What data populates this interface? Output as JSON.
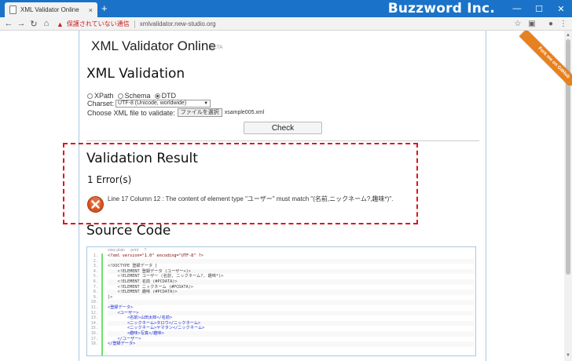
{
  "browser": {
    "tab_title": "XML Validator Online",
    "tab_close": "×",
    "new_tab": "+",
    "brand": "Buzzword Inc.",
    "minimize": "—",
    "maximize": "☐",
    "close": "✕",
    "security_label": "保護されていない通信",
    "url": "xmlvalidator.new-studio.org"
  },
  "app": {
    "title": "XML Validator Online",
    "beta": "BETA",
    "ribbon": "Fork me on GitHub"
  },
  "validation": {
    "heading": "XML Validation",
    "modes": [
      {
        "label": "XPath",
        "checked": false
      },
      {
        "label": "Schema",
        "checked": false
      },
      {
        "label": "DTD",
        "checked": true
      }
    ],
    "charset_label": "Charset:",
    "charset_value": "UTF-8 (Unicode, worldwide)",
    "file_label": "Choose XML file to validate:",
    "file_button": "ファイルを選択",
    "file_name": "xsample005.xml",
    "check_button": "Check"
  },
  "result": {
    "heading": "Validation Result",
    "error_count": "1 Error(s)",
    "error_message": "Line 17 Column 12 : The content of element type \"ユーザー\" must match \"(名前,ニックネーム?,趣味*)\"."
  },
  "source": {
    "heading": "Source Code",
    "toolbar": [
      "view plain",
      "print",
      "?"
    ],
    "lines": [
      "<?xml version=\"1.0\" encoding=\"UTF-8\" ?>",
      "",
      "<!DOCTYPE 登録データ [",
      "    <!ELEMENT 登録データ (ユーザー+)>",
      "    <!ELEMENT ユーザー (名前, ニックネーム?, 趣味*)>",
      "    <!ELEMENT 名前 (#PCDATA)>",
      "    <!ELEMENT ニックネーム (#PCDATA)>",
      "    <!ELEMENT 趣味 (#PCDATA)>",
      "]>",
      "",
      "<登録データ>",
      "    <ユーザー>",
      "        <名前>山田太郎</名前>",
      "        <ニックネーム>タロウ</ニックネーム>",
      "        <ニックネーム>ヤマタン</ニックネーム>",
      "        <趣味>写真</趣味>",
      "    </ユーザー>",
      "</登録データ>"
    ]
  },
  "colors": {
    "chrome_blue": "#1a73c8",
    "ribbon_orange": "#e7801f",
    "highlight_red": "#e0141e",
    "gutter_green": "#6ce26c"
  }
}
